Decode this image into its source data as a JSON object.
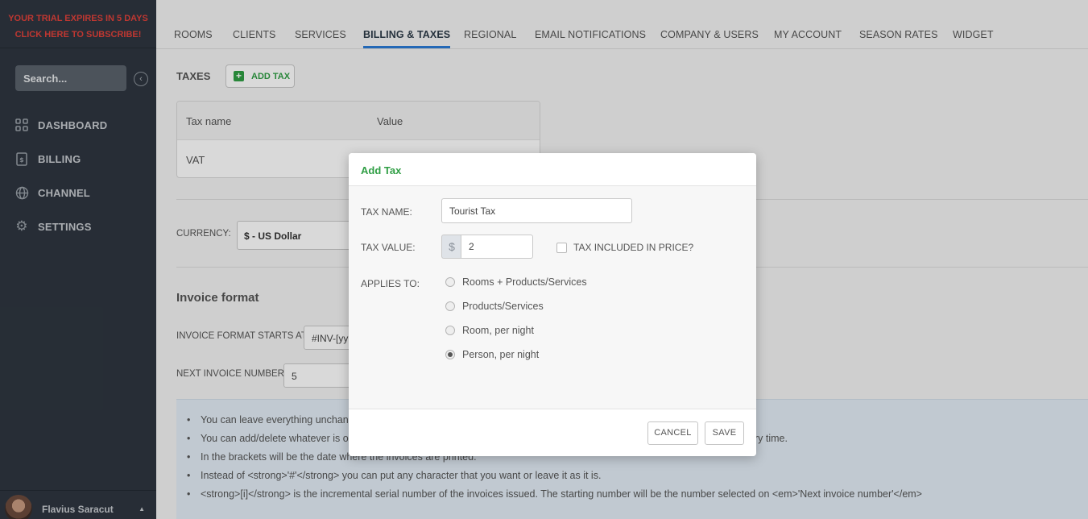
{
  "sidebar": {
    "trial_line1": "YOUR TRIAL EXPIRES IN 5 DAYS",
    "trial_line2": "CLICK HERE TO SUBSCRIBE!",
    "search_placeholder": "Search...",
    "items": [
      {
        "label": "DASHBOARD",
        "icon": "dashboard-grid-icon"
      },
      {
        "label": "BILLING",
        "icon": "billing-dollar-icon"
      },
      {
        "label": "CHANNEL",
        "icon": "globe-icon"
      },
      {
        "label": "SETTINGS",
        "icon": "gear-icon"
      }
    ],
    "user_name": "Flavius Saracut"
  },
  "tabs": [
    {
      "label": "ROOMS",
      "active": false
    },
    {
      "label": "CLIENTS",
      "active": false
    },
    {
      "label": "SERVICES",
      "active": false
    },
    {
      "label": "BILLING & TAXES",
      "active": true
    },
    {
      "label": "REGIONAL",
      "active": false
    },
    {
      "label": "EMAIL NOTIFICATIONS",
      "active": false
    },
    {
      "label": "COMPANY & USERS",
      "active": false
    },
    {
      "label": "MY ACCOUNT",
      "active": false
    },
    {
      "label": "SEASON RATES",
      "active": false
    },
    {
      "label": "WIDGET",
      "active": false
    }
  ],
  "main": {
    "taxes_title": "TAXES",
    "add_tax_label": "ADD TAX",
    "table": {
      "headers": [
        "Tax name",
        "Value"
      ],
      "rows": [
        {
          "name": "VAT",
          "value": ""
        }
      ]
    },
    "currency_label": "CURRENCY:",
    "currency_value": "$ - US Dollar",
    "invoice_title": "Invoice format",
    "invoice_start_label": "INVOICE FORMAT STARTS AT:",
    "invoice_start_value": "#INV-[yy",
    "next_invoice_label": "NEXT INVOICE NUMBER:",
    "next_invoice_value": "5",
    "info": [
      "You can leave everything unchang",
      "You can add/delete whatever is ou                                                                                                                                  ices every time.",
      "In the brackets will be the date where the invoices are printed.",
      "Instead of <strong>'#'</strong> you can put any character that you want or leave it as it is.",
      "<strong>[i]</strong> is the incremental serial number of the invoices issued. The starting number will be the number selected on <em>'Next invoice number'</em>"
    ]
  },
  "modal": {
    "title": "Add Tax",
    "tax_name_label": "TAX NAME:",
    "tax_name_value": "Tourist Tax",
    "tax_value_label": "TAX VALUE:",
    "currency_symbol": "$",
    "tax_value": "2",
    "included_label": "TAX INCLUDED IN PRICE?",
    "included_checked": false,
    "applies_label": "APPLIES TO:",
    "applies_options": [
      {
        "label": "Rooms + Products/Services",
        "checked": false
      },
      {
        "label": "Products/Services",
        "checked": false
      },
      {
        "label": "Room, per night",
        "checked": false
      },
      {
        "label": "Person, per night",
        "checked": true
      }
    ],
    "cancel_label": "CANCEL",
    "save_label": "SAVE"
  },
  "colors": {
    "sidebar_bg": "#2e3640",
    "trial_red": "#e0413a",
    "accent_green": "#2f9e44",
    "active_tab_blue": "#2a7bd6"
  }
}
